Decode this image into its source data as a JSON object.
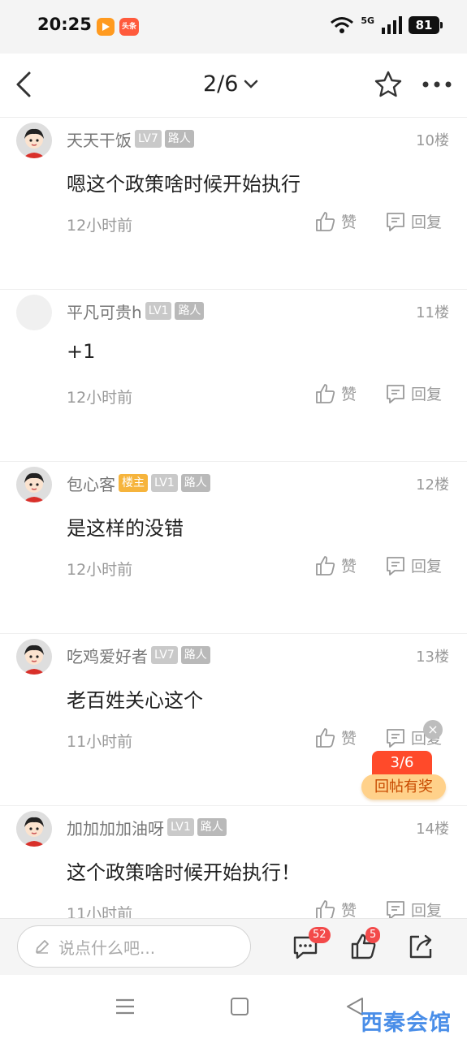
{
  "status_bar": {
    "time": "20:25",
    "network": "5G",
    "battery": "81"
  },
  "header": {
    "page_indicator": "2/6"
  },
  "comments": [
    {
      "username": "天天干饭",
      "level": "LV7",
      "role": "路人",
      "owner_badge": "",
      "floor": "10楼",
      "text": "嗯这个政策啥时候开始执行",
      "time": "12小时前",
      "like_label": "赞",
      "reply_label": "回复",
      "avatar": "cartoon"
    },
    {
      "username": "平凡可贵h",
      "level": "LV1",
      "role": "路人",
      "owner_badge": "",
      "floor": "11楼",
      "text": "+1",
      "time": "12小时前",
      "like_label": "赞",
      "reply_label": "回复",
      "avatar": "blank"
    },
    {
      "username": "包心客",
      "level": "LV1",
      "role": "路人",
      "owner_badge": "楼主",
      "floor": "12楼",
      "text": "是这样的没错",
      "time": "12小时前",
      "like_label": "赞",
      "reply_label": "回复",
      "avatar": "cartoon"
    },
    {
      "username": "吃鸡爱好者",
      "level": "LV7",
      "role": "路人",
      "owner_badge": "",
      "floor": "13楼",
      "text": "老百姓关心这个",
      "time": "11小时前",
      "like_label": "赞",
      "reply_label": "回复",
      "avatar": "cartoon"
    },
    {
      "username": "加加加加油呀",
      "level": "LV1",
      "role": "路人",
      "owner_badge": "",
      "floor": "14楼",
      "text": "这个政策啥时候开始执行！",
      "time": "11小时前",
      "like_label": "赞",
      "reply_label": "回复",
      "avatar": "cartoon"
    }
  ],
  "float_reward": {
    "count": "3/6",
    "label": "回帖有奖"
  },
  "bottom_bar": {
    "placeholder": "说点什么吧...",
    "comment_count": "52",
    "like_count": "5"
  },
  "watermark": "西秦会馆",
  "colors": {
    "accent": "#ff4a2a",
    "owner_badge": "#f6b43c",
    "badge_red": "#f34a4a"
  }
}
